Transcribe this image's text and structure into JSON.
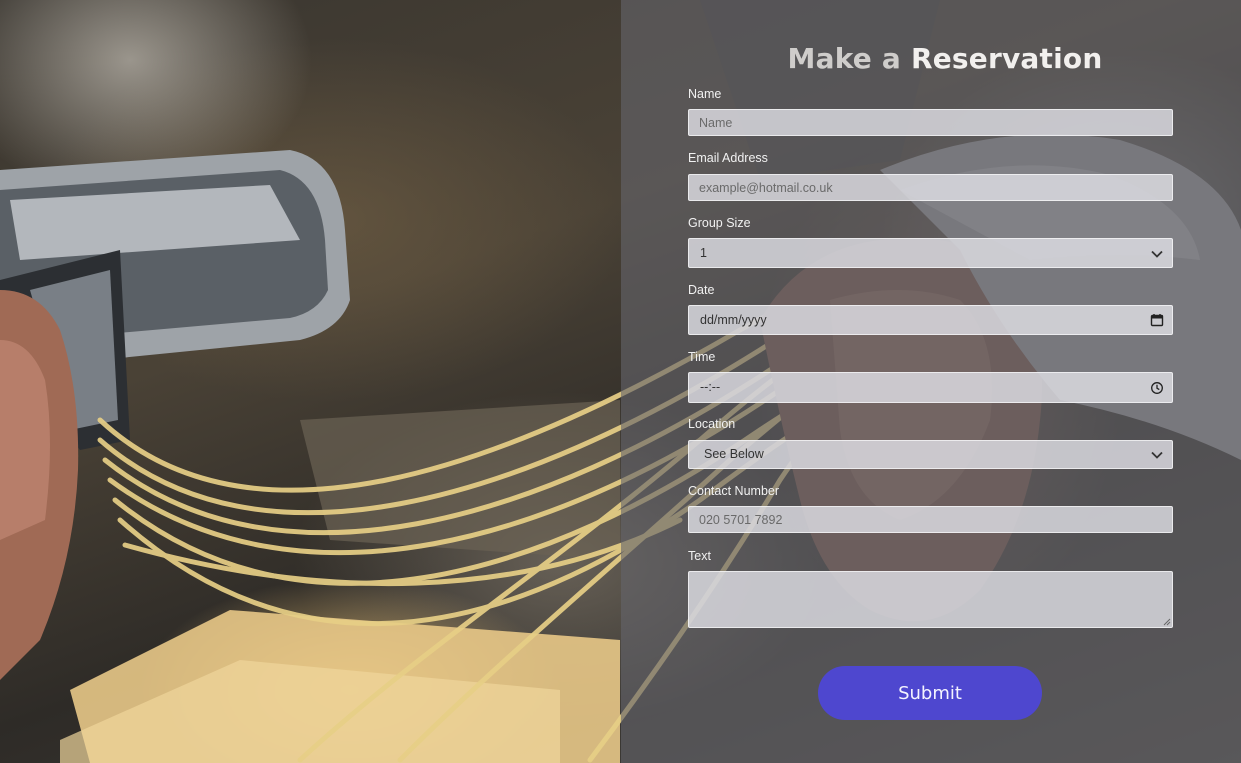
{
  "page": {
    "title_prefix": "Make a ",
    "title_main": "Reservation"
  },
  "background": {
    "image": "pasta-maker-photo",
    "overlay_color": "#64646a"
  },
  "form": {
    "name": {
      "label": "Name",
      "placeholder": "Name"
    },
    "email": {
      "label": "Email Address",
      "placeholder": "example@hotmail.co.uk"
    },
    "group_size": {
      "label": "Group Size",
      "value": "1",
      "icon": "chevron-down-icon"
    },
    "date": {
      "label": "Date",
      "value": "dd/mm/yyyy",
      "icon": "calendar-icon"
    },
    "time": {
      "label": "Time",
      "value": "--:--",
      "icon": "clock-icon"
    },
    "location": {
      "label": "Location",
      "value": "See Below",
      "icon": "chevron-down-icon"
    },
    "contact": {
      "label": "Contact Number",
      "placeholder": "020 5701 7892"
    },
    "text": {
      "label": "Text",
      "placeholder": ""
    },
    "submit_label": "Submit",
    "accent_color": "#4e47cf"
  }
}
